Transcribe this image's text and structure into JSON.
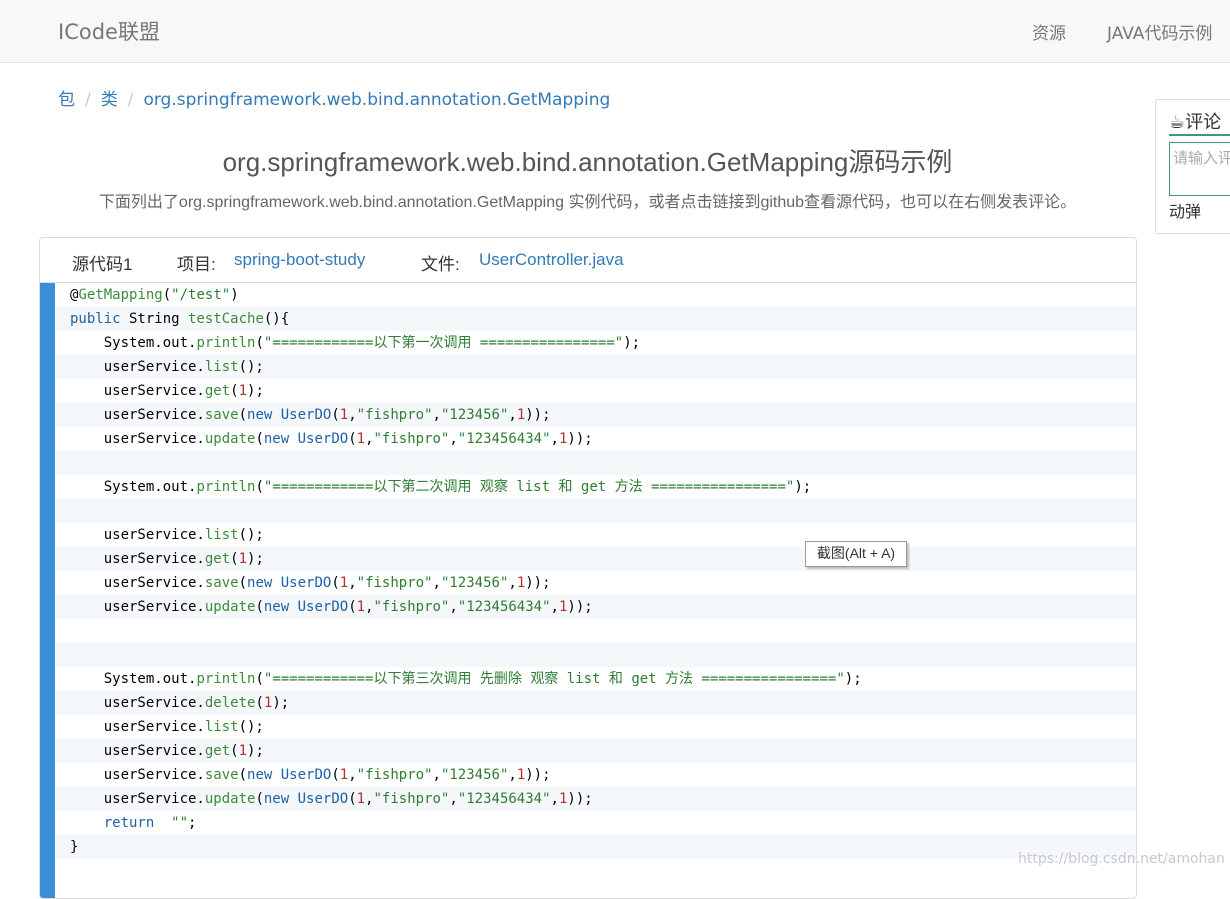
{
  "navbar": {
    "brand": "ICode联盟",
    "links": [
      "资源",
      "JAVA代码示例"
    ]
  },
  "breadcrumb": {
    "items": [
      "包",
      "类",
      "org.springframework.web.bind.annotation.GetMapping"
    ],
    "separator": "/"
  },
  "page": {
    "title": "org.springframework.web.bind.annotation.GetMapping源码示例",
    "description": "下面列出了org.springframework.web.bind.annotation.GetMapping 实例代码，或者点击链接到github查看源代码，也可以在右侧发表评论。"
  },
  "code_panel": {
    "source_label": "源代码1",
    "project_label": "项目:",
    "project_name": "spring-boot-study",
    "file_label": "文件:",
    "file_name": "UserController.java",
    "lines": [
      "@GetMapping(\"/test\")",
      "public String testCache(){",
      "    System.out.println(\"============以下第一次调用 ================\");",
      "    userService.list();",
      "    userService.get(1);",
      "    userService.save(new UserDO(1,\"fishpro\",\"123456\",1));",
      "    userService.update(new UserDO(1,\"fishpro\",\"123456434\",1));",
      "",
      "    System.out.println(\"============以下第二次调用 观察 list 和 get 方法 ================\");",
      "",
      "    userService.list();",
      "    userService.get(1);",
      "    userService.save(new UserDO(1,\"fishpro\",\"123456\",1));",
      "    userService.update(new UserDO(1,\"fishpro\",\"123456434\",1));",
      "",
      "",
      "    System.out.println(\"============以下第三次调用 先删除 观察 list 和 get 方法 ================\");",
      "    userService.delete(1);",
      "    userService.list();",
      "    userService.get(1);",
      "    userService.save(new UserDO(1,\"fishpro\",\"123456\",1));",
      "    userService.update(new UserDO(1,\"fishpro\",\"123456434\",1));",
      "    return  \"\";",
      "}"
    ]
  },
  "tooltip": "截图(Alt + A)",
  "comment_sidebar": {
    "title": "评论",
    "icon": "coffee-icon",
    "placeholder": "请输入评论",
    "footer": "动弹"
  },
  "watermark": "https://blog.csdn.net/amohan",
  "colors": {
    "accent": "#337ab7",
    "gutter": "#3a8fd6",
    "comment_border": "#3c9a6e"
  }
}
